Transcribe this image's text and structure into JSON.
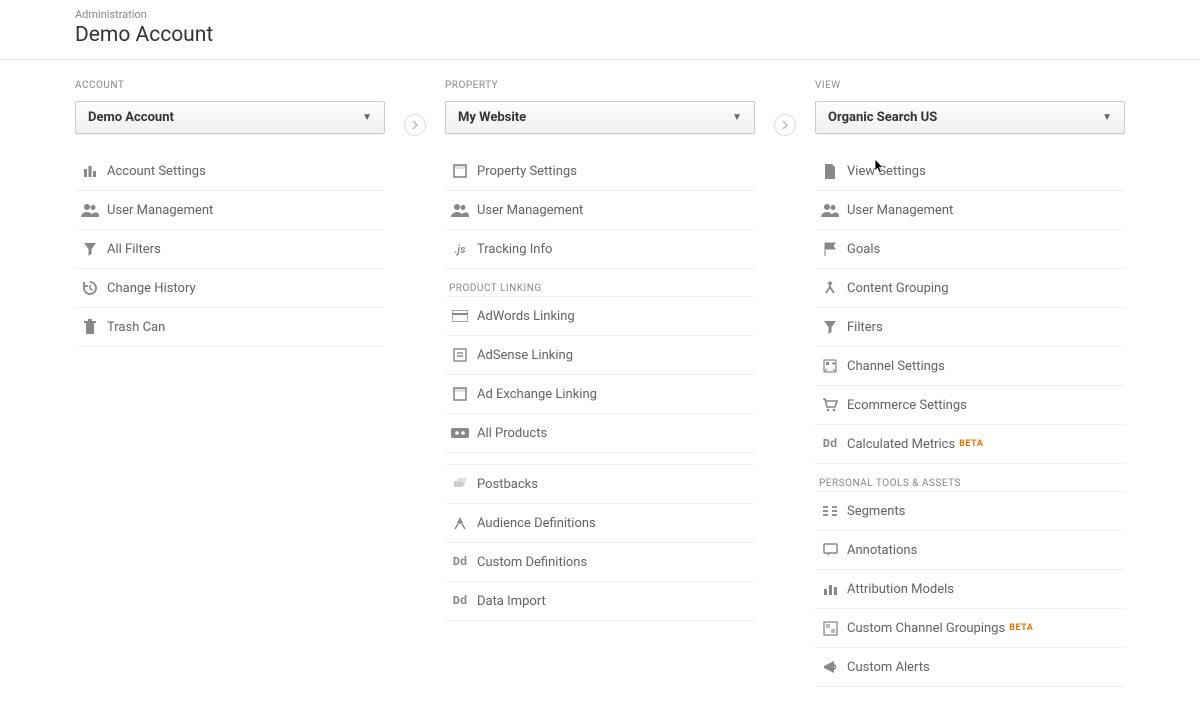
{
  "header": {
    "breadcrumb": "Administration",
    "title": "Demo Account"
  },
  "columns": {
    "account": {
      "label": "ACCOUNT",
      "selected": "Demo Account",
      "items": [
        {
          "icon": "settings-bars-icon",
          "label": "Account Settings"
        },
        {
          "icon": "users-icon",
          "label": "User Management"
        },
        {
          "icon": "funnel-icon",
          "label": "All Filters"
        },
        {
          "icon": "history-icon",
          "label": "Change History"
        },
        {
          "icon": "trash-icon",
          "label": "Trash Can"
        }
      ]
    },
    "property": {
      "label": "PROPERTY",
      "selected": "My Website",
      "items": [
        {
          "icon": "square-icon",
          "label": "Property Settings"
        },
        {
          "icon": "users-icon",
          "label": "User Management"
        },
        {
          "icon": "js-icon",
          "label": "Tracking Info"
        }
      ],
      "product_linking_label": "PRODUCT LINKING",
      "product_linking": [
        {
          "icon": "card-icon",
          "label": "AdWords Linking"
        },
        {
          "icon": "doc-icon",
          "label": "AdSense Linking"
        },
        {
          "icon": "square-icon",
          "label": "Ad Exchange Linking"
        },
        {
          "icon": "infinity-icon",
          "label": "All Products"
        }
      ],
      "extras": [
        {
          "icon": "postbacks-icon",
          "label": "Postbacks"
        },
        {
          "icon": "audience-icon",
          "label": "Audience Definitions"
        },
        {
          "icon": "dd-icon",
          "label": "Custom Definitions"
        },
        {
          "icon": "dd-icon",
          "label": "Data Import"
        }
      ]
    },
    "view": {
      "label": "VIEW",
      "selected": "Organic Search US",
      "items": [
        {
          "icon": "page-icon",
          "label": "View Settings"
        },
        {
          "icon": "users-icon",
          "label": "User Management"
        },
        {
          "icon": "flag-icon",
          "label": "Goals"
        },
        {
          "icon": "merge-icon",
          "label": "Content Grouping"
        },
        {
          "icon": "funnel-icon",
          "label": "Filters"
        },
        {
          "icon": "channel-icon",
          "label": "Channel Settings"
        },
        {
          "icon": "cart-icon",
          "label": "Ecommerce Settings"
        },
        {
          "icon": "dd-icon",
          "label": "Calculated Metrics",
          "beta": "BETA"
        }
      ],
      "personal_label": "PERSONAL TOOLS & ASSETS",
      "personal": [
        {
          "icon": "segments-icon",
          "label": "Segments"
        },
        {
          "icon": "annotation-icon",
          "label": "Annotations"
        },
        {
          "icon": "bars-icon",
          "label": "Attribution Models"
        },
        {
          "icon": "grouping-icon",
          "label": "Custom Channel Groupings",
          "beta": "BETA"
        },
        {
          "icon": "alert-icon",
          "label": "Custom Alerts"
        }
      ]
    }
  }
}
